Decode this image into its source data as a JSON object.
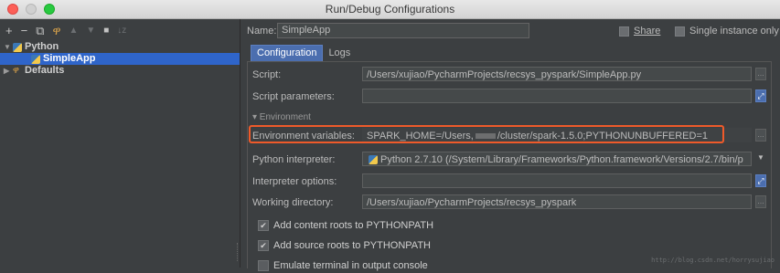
{
  "window": {
    "title": "Run/Debug Configurations"
  },
  "toolbar": {
    "add": "+",
    "remove": "−",
    "copy": "⧉",
    "edit_defaults": "ዋ",
    "move_up": "▲",
    "move_down": "▼",
    "folder": "■",
    "sort": "↓z"
  },
  "tree": {
    "python": "Python",
    "simpleapp": "SimpleApp",
    "defaults": "Defaults"
  },
  "header": {
    "name_label": "Name:",
    "name_value": "SimpleApp",
    "share_label": "Share",
    "single_instance_label": "Single instance only"
  },
  "tabs": [
    "Configuration",
    "Logs"
  ],
  "form": {
    "script_label": "Script:",
    "script_value": "/Users/xujiao/PycharmProjects/recsys_pyspark/SimpleApp.py",
    "script_params_label": "Script parameters:",
    "script_params_value": "",
    "environment_header": "▾ Environment",
    "env_vars_label": "Environment variables:",
    "env_vars_prefix": "SPARK_HOME=/Users,",
    "env_vars_suffix": "/cluster/spark-1.5.0;PYTHONUNBUFFERED=1",
    "interpreter_label": "Python interpreter:",
    "interpreter_value": "Python 2.7.10 (/System/Library/Frameworks/Python.framework/Versions/2.7/bin/p",
    "interpreter_options_label": "Interpreter options:",
    "interpreter_options_value": "",
    "working_dir_label": "Working directory:",
    "working_dir_value": "/Users/xujiao/PycharmProjects/recsys_pyspark"
  },
  "options": {
    "add_content_roots": "Add content roots to PYTHONPATH",
    "add_source_roots": "Add source roots to PYTHONPATH",
    "emulate_terminal": "Emulate terminal in output console"
  },
  "watermark": "http://blog.csdn.net/horrysujiao",
  "colors": {
    "selection": "#2f65ca",
    "highlight_border": "#ef5a2a",
    "panel_bg": "#3c3f41"
  }
}
